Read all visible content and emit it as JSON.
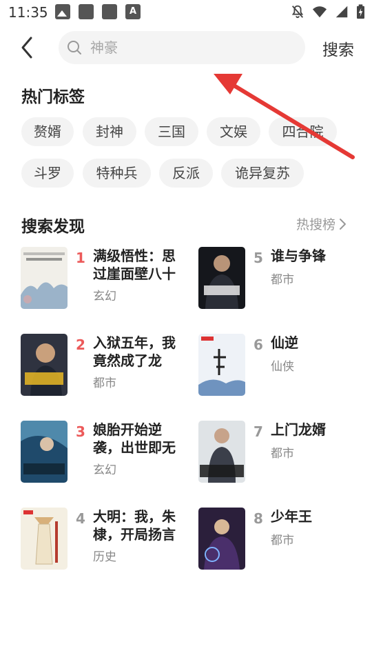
{
  "status_bar": {
    "time": "11:35",
    "left_icons": [
      "image-icon",
      "notification-square-icon",
      "notification-square-icon",
      "text-a-icon"
    ],
    "right_icons": [
      "mute-bell-icon",
      "wifi-icon",
      "cell-signal-icon",
      "battery-charging-icon"
    ]
  },
  "header": {
    "search_placeholder": "神豪",
    "search_label": "搜索"
  },
  "hot_tags": {
    "title": "热门标签",
    "tags": [
      "赘婿",
      "封神",
      "三国",
      "文娱",
      "四合院",
      "斗罗",
      "特种兵",
      "反派",
      "诡异复苏"
    ]
  },
  "discover": {
    "title": "搜索发现",
    "hot_rank_label": "热搜榜",
    "books": [
      {
        "rank": "1",
        "title": "满级悟性：思过崖面壁八十",
        "genre": "玄幻"
      },
      {
        "rank": "2",
        "title": "入狱五年，我竟然成了龙",
        "genre": "都市"
      },
      {
        "rank": "3",
        "title": "娘胎开始逆袭，出世即无",
        "genre": "玄幻"
      },
      {
        "rank": "4",
        "title": "大明：我，朱棣，开局扬言",
        "genre": "历史"
      },
      {
        "rank": "5",
        "title": "谁与争锋",
        "genre": "都市"
      },
      {
        "rank": "6",
        "title": "仙逆",
        "genre": "仙侠"
      },
      {
        "rank": "7",
        "title": "上门龙婿",
        "genre": "都市"
      },
      {
        "rank": "8",
        "title": "少年王",
        "genre": "都市"
      }
    ]
  },
  "colors": {
    "accent_rank": "#ec5a5a",
    "annotation_arrow": "#e53935"
  }
}
